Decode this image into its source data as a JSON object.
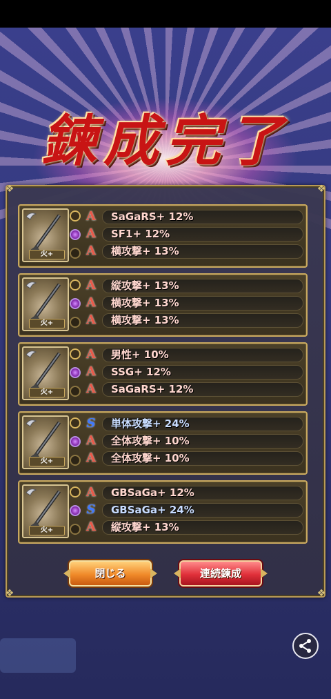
{
  "title": "鍊成完了",
  "cards": [
    {
      "element": "火+",
      "effects": [
        {
          "grade": "A",
          "text": "SaGaRS+ 12%"
        },
        {
          "grade": "A",
          "text": "SF1+ 12%"
        },
        {
          "grade": "A",
          "text": "横攻撃+ 13%"
        }
      ]
    },
    {
      "element": "火+",
      "effects": [
        {
          "grade": "A",
          "text": "縦攻撃+ 13%"
        },
        {
          "grade": "A",
          "text": "横攻撃+ 13%"
        },
        {
          "grade": "A",
          "text": "横攻撃+ 13%"
        }
      ]
    },
    {
      "element": "火+",
      "effects": [
        {
          "grade": "A",
          "text": "男性+ 10%"
        },
        {
          "grade": "A",
          "text": "SSG+ 12%"
        },
        {
          "grade": "A",
          "text": "SaGaRS+ 12%"
        }
      ]
    },
    {
      "element": "火+",
      "effects": [
        {
          "grade": "S",
          "text": "単体攻撃+ 24%"
        },
        {
          "grade": "A",
          "text": "全体攻撃+ 10%"
        },
        {
          "grade": "A",
          "text": "全体攻撃+ 10%"
        }
      ]
    },
    {
      "element": "火+",
      "effects": [
        {
          "grade": "A",
          "text": "GBSaGa+ 12%"
        },
        {
          "grade": "S",
          "text": "GBSaGa+ 24%"
        },
        {
          "grade": "A",
          "text": "縦攻撃+ 13%"
        }
      ]
    }
  ],
  "buttons": {
    "close_label": "閉じる",
    "again_label": "連続鍊成"
  },
  "icons": {
    "weapon": "spear-icon",
    "share": "share-icon"
  },
  "colors": {
    "grade_a": "#e85a4a",
    "grade_s": "#3e78ff",
    "title": "#c81414"
  }
}
